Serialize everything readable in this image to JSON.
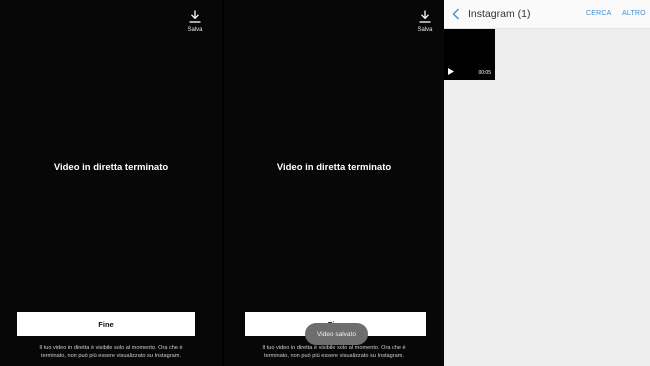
{
  "screens": [
    {
      "save_label": "Salva",
      "title": "Video in diretta terminato",
      "done_button": "Fine",
      "note_line1": "Il tuo video in diretta è visibile solo al momento. Ora che è",
      "note_line2": "terminato, non può più essere visualizzato su Instagram."
    },
    {
      "save_label": "Salva",
      "title": "Video in diretta terminato",
      "done_button": "Fine",
      "toast": "Video salvato",
      "note_line1": "Il tuo video in diretta è visibile solo al momento. Ora che è",
      "note_line2": "terminato, non può più essere visualizzato su Instagram."
    }
  ],
  "gallery": {
    "title": "Instagram (1)",
    "search": "CERCA",
    "more": "ALTRO",
    "items": [
      {
        "duration": "00:05",
        "icon": "play-icon"
      }
    ]
  },
  "colors": {
    "dark_bg": "#070707",
    "gallery_bg": "#eeeeee",
    "accent": "#3d8fd3"
  }
}
